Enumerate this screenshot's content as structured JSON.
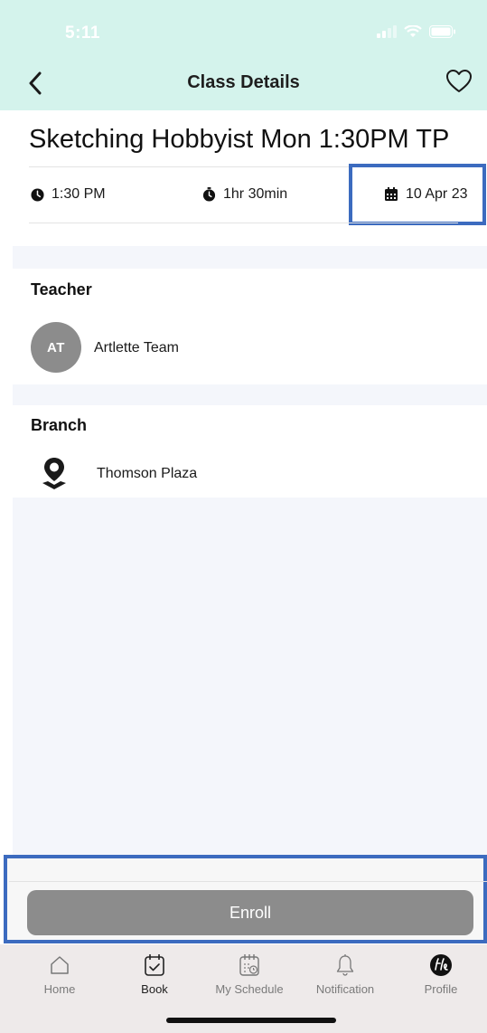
{
  "status_bar": {
    "time": "5:11"
  },
  "header": {
    "title": "Class Details",
    "back_icon": "chevron-left-icon",
    "favorite_icon": "heart-outline-icon"
  },
  "class": {
    "title": "Sketching Hobbyist Mon 1:30PM TP",
    "time": "1:30 PM",
    "duration": "1hr 30min",
    "date": "10 Apr 23"
  },
  "teacher": {
    "section_title": "Teacher",
    "initials": "AT",
    "name": "Artlette Team"
  },
  "branch": {
    "section_title": "Branch",
    "name": "Thomson Plaza"
  },
  "enroll": {
    "label": "Enroll"
  },
  "tabs": [
    {
      "label": "Home",
      "icon": "home-icon"
    },
    {
      "label": "Book",
      "icon": "calendar-check-icon",
      "active": true
    },
    {
      "label": "My Schedule",
      "icon": "calendar-clock-icon"
    },
    {
      "label": "Notification",
      "icon": "bell-icon"
    },
    {
      "label": "Profile",
      "icon": "profile-logo-icon"
    }
  ],
  "colors": {
    "header_bg": "#d4f3ec",
    "highlight_border": "#3c6bbf",
    "button_gray": "#8c8c8c",
    "content_bg": "#f4f6fb",
    "tabbar_bg": "#eeeaea"
  }
}
